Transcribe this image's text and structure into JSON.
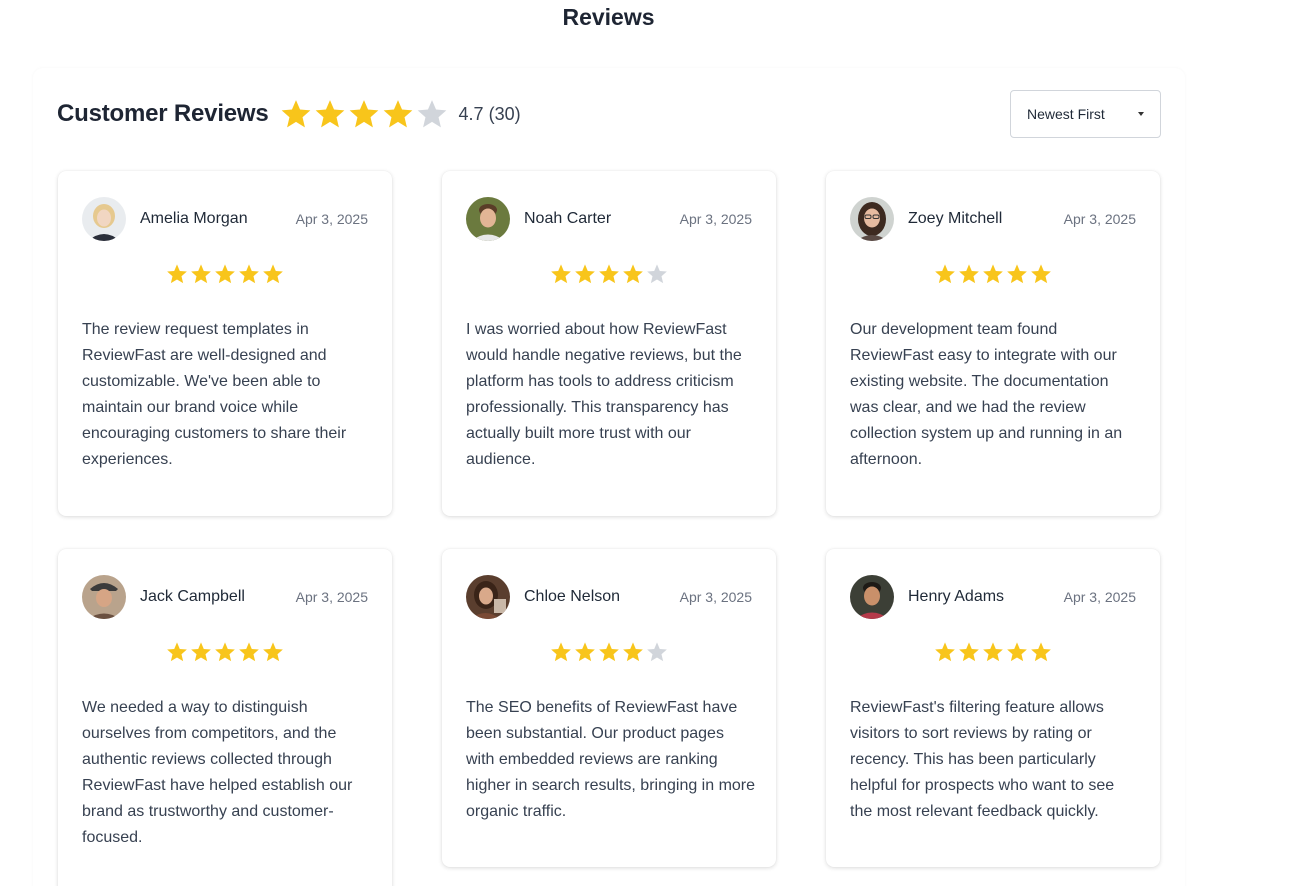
{
  "page": {
    "title": "Reviews"
  },
  "header": {
    "heading": "Customer Reviews",
    "rating": 4.7,
    "stars_filled": 4,
    "stars_total": 5,
    "summary": "4.7 (30)",
    "sort_label": "Newest First"
  },
  "colors": {
    "star_filled": "#f8c51b",
    "star_empty": "#d1d5db",
    "text": "#1e2533"
  },
  "reviews": [
    {
      "name": "Amelia Morgan",
      "date": "Apr 3, 2025",
      "stars": 5,
      "text": "The review request templates in ReviewFast are well-designed and customizable. We've been able to maintain our brand voice while encouraging customers to share their experiences."
    },
    {
      "name": "Noah Carter",
      "date": "Apr 3, 2025",
      "stars": 4,
      "text": "I was worried about how ReviewFast would handle negative reviews, but the platform has tools to address criticism professionally. This transparency has actually built more trust with our audience."
    },
    {
      "name": "Zoey Mitchell",
      "date": "Apr 3, 2025",
      "stars": 5,
      "text": "Our development team found ReviewFast easy to integrate with our existing website. The documentation was clear, and we had the review collection system up and running in an afternoon."
    },
    {
      "name": "Jack Campbell",
      "date": "Apr 3, 2025",
      "stars": 5,
      "text": "We needed a way to distinguish ourselves from competitors, and the authentic reviews collected through ReviewFast have helped establish our brand as trustworthy and customer-focused."
    },
    {
      "name": "Chloe Nelson",
      "date": "Apr 3, 2025",
      "stars": 4,
      "text": "The SEO benefits of ReviewFast have been substantial. Our product pages with embedded reviews are ranking higher in search results, bringing in more organic traffic."
    },
    {
      "name": "Henry Adams",
      "date": "Apr 3, 2025",
      "stars": 5,
      "text": "ReviewFast's filtering feature allows visitors to sort reviews by rating or recency. This has been particularly helpful for prospects who want to see the most relevant feedback quickly."
    }
  ]
}
